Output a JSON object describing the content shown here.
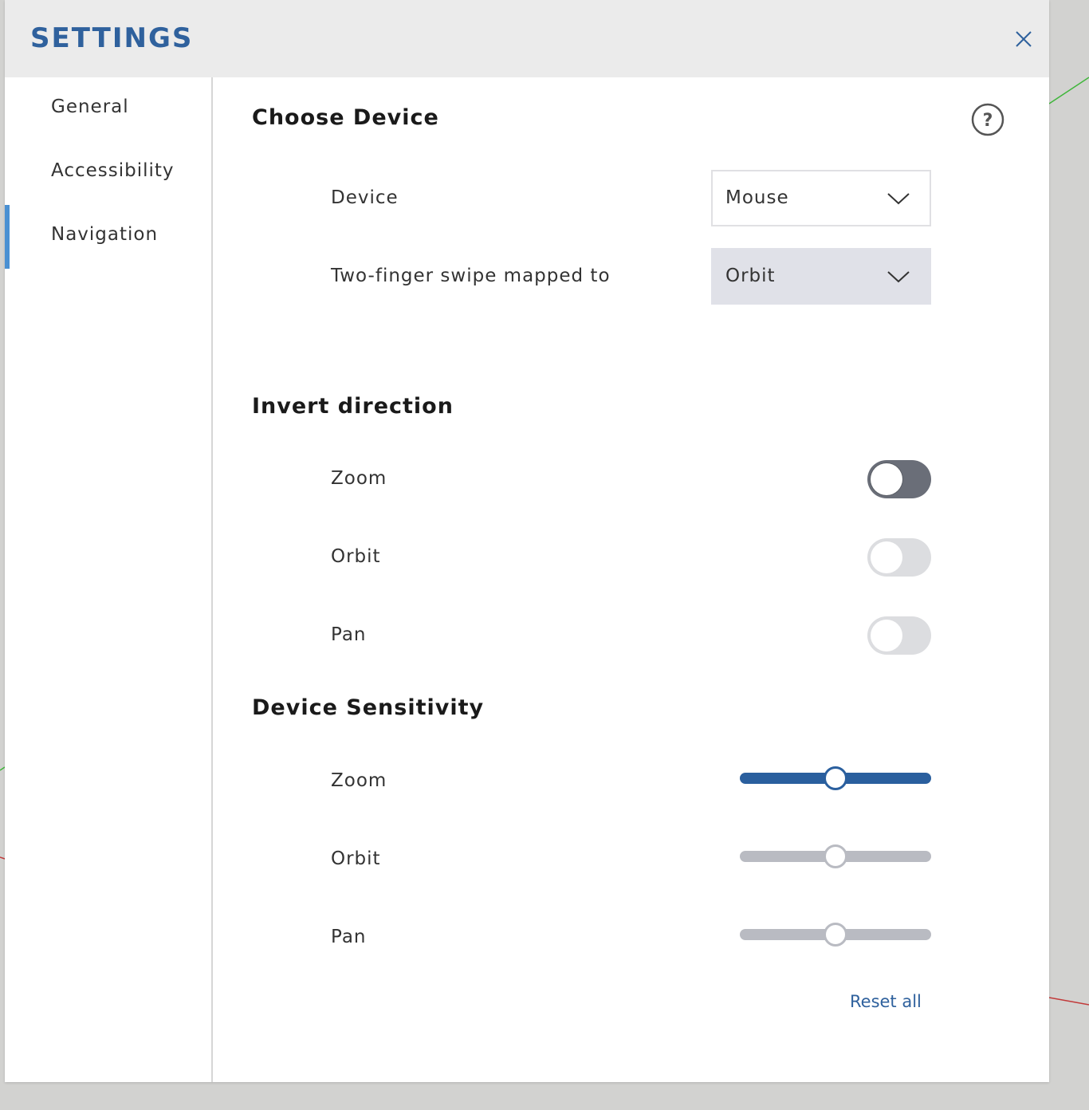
{
  "dialog": {
    "title": "SETTINGS",
    "close_icon": "close-icon",
    "help_icon": "help-icon"
  },
  "sidebar": {
    "items": [
      {
        "label": "General",
        "active": false
      },
      {
        "label": "Accessibility",
        "active": false
      },
      {
        "label": "Navigation",
        "active": true
      }
    ]
  },
  "choose_device": {
    "title": "Choose Device",
    "device_label": "Device",
    "device_value": "Mouse",
    "swipe_label": "Two-finger swipe mapped to",
    "swipe_value": "Orbit"
  },
  "invert_direction": {
    "title": "Invert direction",
    "items": [
      {
        "label": "Zoom",
        "on": false
      },
      {
        "label": "Orbit",
        "on": false
      },
      {
        "label": "Pan",
        "on": false
      }
    ]
  },
  "device_sensitivity": {
    "title": "Device Sensitivity",
    "items": [
      {
        "label": "Zoom",
        "value": 0.5
      },
      {
        "label": "Orbit",
        "value": 0.5
      },
      {
        "label": "Pan",
        "value": 0.5
      }
    ]
  },
  "reset_label": "Reset all",
  "colors": {
    "accent": "#2f619d",
    "nav_active": "#4a90d2",
    "toggle_focus": "#6a6e78"
  }
}
